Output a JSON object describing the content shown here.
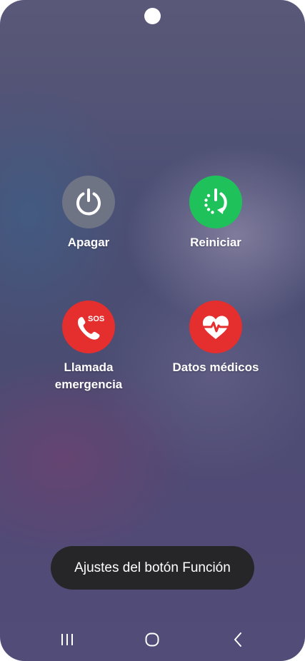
{
  "power_menu": {
    "options": [
      {
        "label": "Apagar",
        "icon": "power-icon",
        "color": "#6f7484"
      },
      {
        "label": "Reiniciar",
        "icon": "restart-icon",
        "color": "#1fc25a"
      },
      {
        "label": "Llamada emergencia",
        "line1": "Llamada",
        "line2": "emergencia",
        "icon": "sos-phone-icon",
        "badge": "SOS",
        "color": "#e52e2e"
      },
      {
        "label": "Datos médicos",
        "icon": "heart-pulse-icon",
        "color": "#e52e2e"
      }
    ],
    "function_key_button": "Ajustes del botón Función"
  },
  "navbar": {
    "recent_icon": "recent-apps-icon",
    "home_icon": "home-icon",
    "back_icon": "back-icon"
  }
}
